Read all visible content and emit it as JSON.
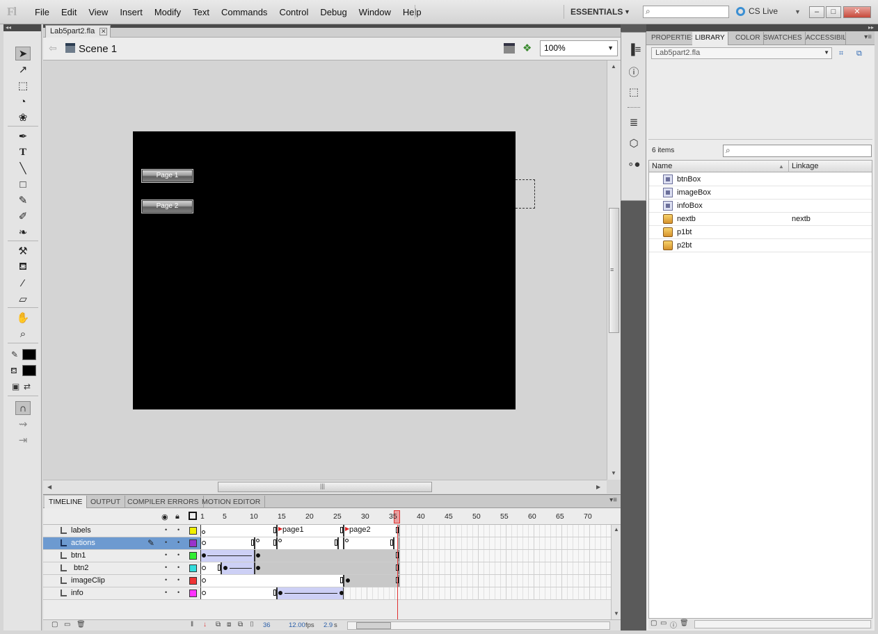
{
  "app": {
    "logo": "Fl"
  },
  "menu": [
    "File",
    "Edit",
    "View",
    "Insert",
    "Modify",
    "Text",
    "Commands",
    "Control",
    "Debug",
    "Window",
    "Help"
  ],
  "workspace": {
    "label": "ESSENTIALS",
    "arrow": "▼"
  },
  "top_search": {
    "placeholder": ""
  },
  "cslive": {
    "label": "CS Live",
    "arrow": "▼"
  },
  "window_controls": {
    "minimize": "–",
    "maximize": "□",
    "close": "✕"
  },
  "document": {
    "tab_label": "Lab5part2.fla",
    "close": "✕"
  },
  "scene": {
    "label": "Scene 1",
    "zoom": "100%"
  },
  "stage": {
    "background": "#000000",
    "buttons": [
      {
        "label": "Page 1"
      },
      {
        "label": "Page 2"
      }
    ]
  },
  "timeline": {
    "tabs": [
      "TIMELINE",
      "OUTPUT",
      "COMPILER ERRORS",
      "MOTION EDITOR"
    ],
    "ruler": [
      "1",
      "5",
      "10",
      "15",
      "20",
      "25",
      "30",
      "35",
      "40",
      "45",
      "50",
      "55",
      "60",
      "65",
      "70"
    ],
    "layers": [
      {
        "name": "labels",
        "color": "#f0f000"
      },
      {
        "name": "actions",
        "color": "#9933cc",
        "selected": true
      },
      {
        "name": "btn1",
        "color": "#33ee33"
      },
      {
        "name": "btn2",
        "color": "#33dddd"
      },
      {
        "name": "imageClip",
        "color": "#ee3333"
      },
      {
        "name": "info",
        "color": "#ff33ff"
      }
    ],
    "frame_labels": [
      "page1",
      "page2"
    ],
    "status": {
      "current_frame": "36",
      "fps": "12.00",
      "fps_unit": "fps",
      "time": "2.9",
      "time_unit": "s"
    }
  },
  "panel": {
    "tabs": [
      "PROPERTIES",
      "LIBRARY",
      "COLOR",
      "SWATCHES",
      "ACCESSIBILIT"
    ],
    "active_tab": "LIBRARY"
  },
  "library": {
    "document": "Lab5part2.fla",
    "count": "6 items",
    "search_placeholder": "",
    "columns": {
      "name": "Name",
      "linkage": "Linkage"
    },
    "items": [
      {
        "name": "btnBox",
        "type": "movieclip",
        "linkage": ""
      },
      {
        "name": "imageBox",
        "type": "movieclip",
        "linkage": ""
      },
      {
        "name": "infoBox",
        "type": "movieclip",
        "linkage": ""
      },
      {
        "name": "nextb",
        "type": "button",
        "linkage": "nextb"
      },
      {
        "name": "p1bt",
        "type": "button",
        "linkage": ""
      },
      {
        "name": "p2bt",
        "type": "button",
        "linkage": ""
      }
    ]
  }
}
